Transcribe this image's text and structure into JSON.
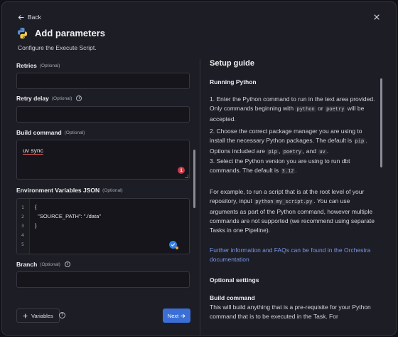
{
  "header": {
    "back_label": "Back",
    "title": "Add parameters",
    "subtitle": "Configure the Execute Script."
  },
  "fields": {
    "retries": {
      "label": "Retries",
      "optional": "(Optional)",
      "value": ""
    },
    "retry_delay": {
      "label": "Retry delay",
      "optional": "(Optional)",
      "value": ""
    },
    "build_command": {
      "label": "Build command",
      "optional": "(Optional)",
      "value": "uv sync",
      "error_count": "1"
    },
    "env_json": {
      "label": "Environment Variables JSON",
      "optional": "(Optional)",
      "lines": [
        "{",
        "  \"SOURCE_PATH\": \"./data\"",
        "}",
        "",
        ""
      ],
      "line_numbers": [
        "1",
        "2",
        "3",
        "4",
        "5"
      ]
    },
    "branch": {
      "label": "Branch",
      "optional": "(Optional)",
      "value": ""
    }
  },
  "footer": {
    "variables_label": "Variables",
    "next_label": "Next"
  },
  "guide": {
    "title": "Setup guide",
    "section1": "Running Python",
    "p1_a": "1. Enter the Python command to run in the text area provided. Only commands beginning with ",
    "p1_code1": "python",
    "p1_b": " or ",
    "p1_code2": "poetry",
    "p1_c": " will be accepted.",
    "p2_a": "2. Choose the correct package manager you are using to install the necessary Python packages. The default is ",
    "p2_code1": "pip",
    "p2_b": ". Options included are ",
    "p2_code2": "pip",
    "p2_c": ", ",
    "p2_code3": "poetry",
    "p2_d": ", and ",
    "p2_code4": "uv",
    "p2_e": ".",
    "p3_a": "3. Select the Python version you are using to run dbt commands. The default is ",
    "p3_code": "3.12",
    "p3_b": ".",
    "p4_a": "For example, to run a script that is at the root level of your repository, input ",
    "p4_code": "python my_script.py",
    "p4_b": ". You can use arguments as part of the Python command, however multiple commands are not supported (we recommend using separate Tasks in one Pipeline).",
    "link": "Further information and FAQs can be found in the Orchestra documentation",
    "section2": "Optional settings",
    "sub1": "Build command",
    "p5": "This will build anything that is a pre-requisite for your Python command that is to be executed in the Task. For"
  },
  "colors": {
    "accent": "#3b6fd6",
    "link": "#7696e6",
    "error": "#c53a48",
    "ok": "#2f7ee6"
  }
}
